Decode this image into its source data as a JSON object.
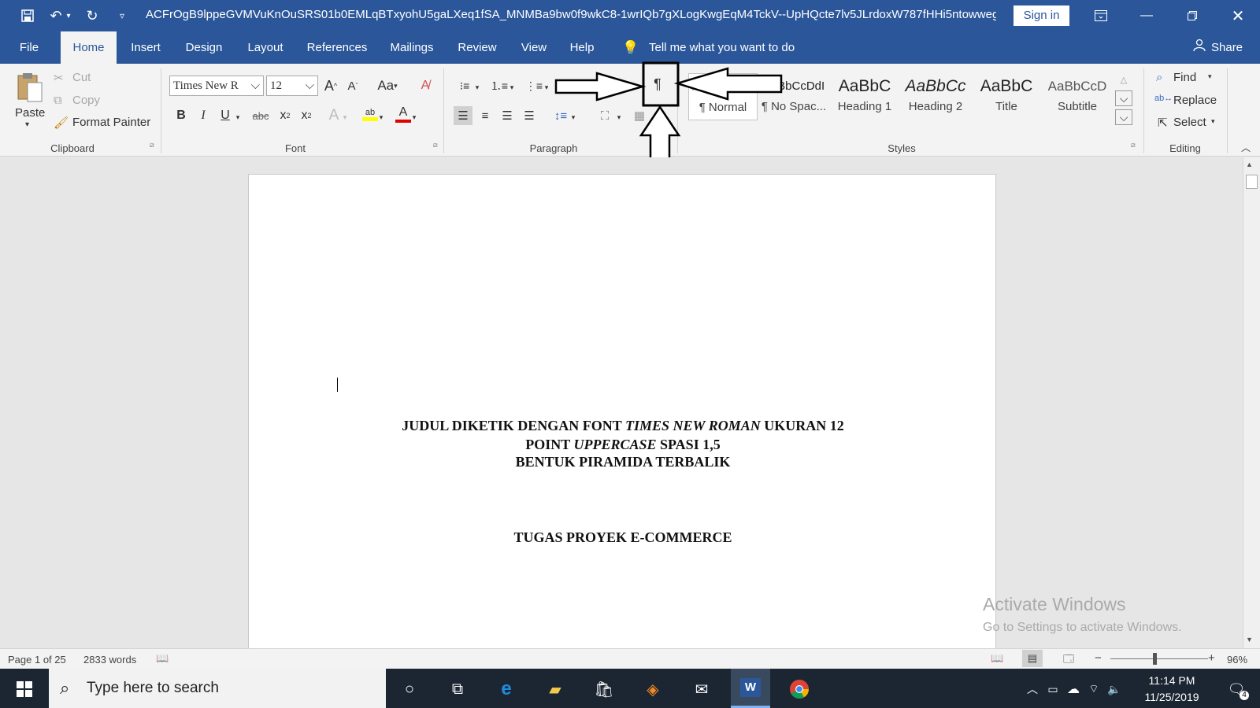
{
  "titlebar": {
    "doc_title": "ACFrOgB9lppeGVMVuKnOuSRS01b0EMLqBTxyohU5gaLXeq1fSA_MNMBa9bw0f9wkC8-1wrIQb7gXLogKwgEqM4TckV--UpHQcte7lv5JLrdoxW787fHHi5ntowwegks...",
    "sign_in": "Sign in"
  },
  "tabs": [
    "File",
    "Home",
    "Insert",
    "Design",
    "Layout",
    "References",
    "Mailings",
    "Review",
    "View",
    "Help"
  ],
  "tell_me": "Tell me what you want to do",
  "share": "Share",
  "clipboard": {
    "paste": "Paste",
    "cut": "Cut",
    "copy": "Copy",
    "format_painter": "Format Painter",
    "label": "Clipboard"
  },
  "font": {
    "name": "Times New R",
    "size": "12",
    "label": "Font",
    "grow": "A",
    "shrink": "A",
    "case": "Aa",
    "bold": "B",
    "italic": "I",
    "underline": "U",
    "strike": "abc",
    "sub": "x",
    "sup": "x"
  },
  "paragraph": {
    "label": "Paragraph",
    "pilcrow": "¶"
  },
  "styles": {
    "label": "Styles",
    "items": [
      {
        "preview": "AaBbCcDdI",
        "name": "¶ Normal"
      },
      {
        "preview": "AaBbCcDdI",
        "name": "¶ No Spac..."
      },
      {
        "preview": "AaBbC",
        "name": "Heading 1"
      },
      {
        "preview": "AaBbCc",
        "name": "Heading 2"
      },
      {
        "preview": "AaBbC",
        "name": "Title"
      },
      {
        "preview": "AaBbCcD",
        "name": "Subtitle"
      }
    ]
  },
  "editing": {
    "find": "Find",
    "replace": "Replace",
    "select": "Select",
    "label": "Editing"
  },
  "document": {
    "line1a": "JUDUL DIKETIK DENGAN FONT ",
    "line1b": "TIMES NEW ROMAN",
    "line1c": " UKURAN 12",
    "line2a": "POINT ",
    "line2b": "UPPERCASE",
    "line2c": " SPASI 1,5",
    "line3": "BENTUK PIRAMIDA TERBALIK",
    "line4": "TUGAS PROYEK E-COMMERCE"
  },
  "watermark": {
    "title": "Activate Windows",
    "sub": "Go to Settings to activate Windows."
  },
  "status": {
    "page": "Page 1 of 25",
    "words": "2833 words",
    "zoom": "96%"
  },
  "taskbar": {
    "search_placeholder": "Type here to search",
    "time": "11:14 PM",
    "date": "11/25/2019",
    "notifications": "4"
  },
  "colors": {
    "word_blue": "#2b579a",
    "taskbar": "#1c2633",
    "highlight_yellow": "#ffff00",
    "font_red": "#e00000"
  }
}
